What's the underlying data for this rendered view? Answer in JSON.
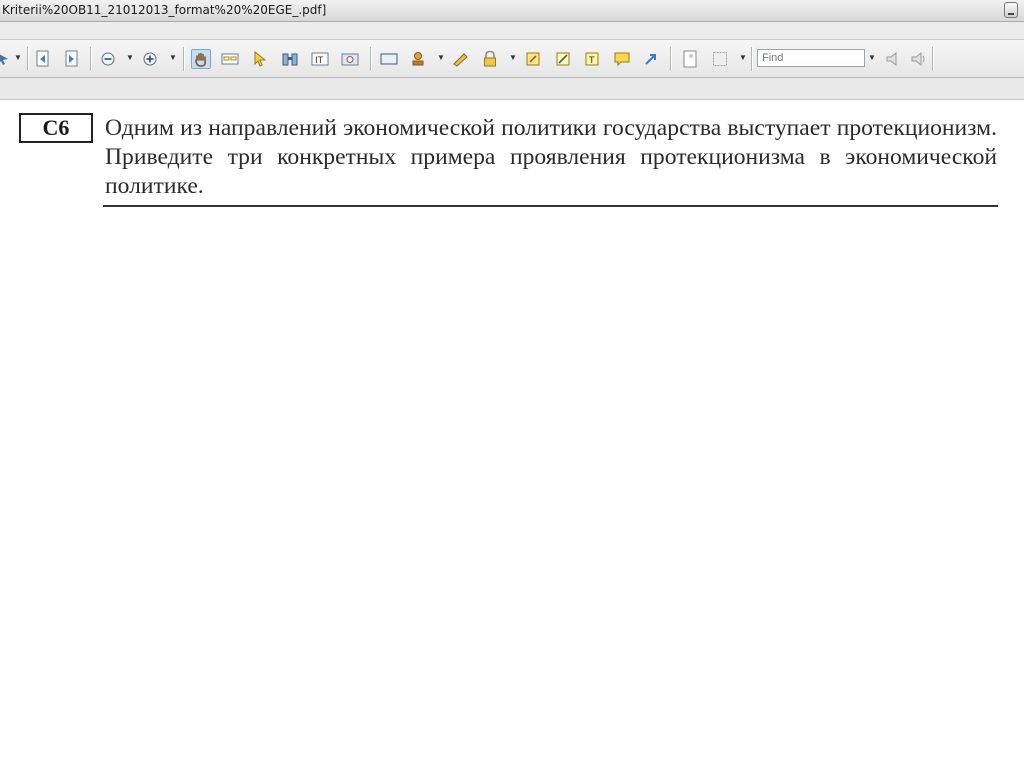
{
  "window": {
    "title": "Kriterii%20OB11_21012013_format%20%20EGE_.pdf]"
  },
  "toolbar": {
    "find_placeholder": "Find",
    "icons": [
      "arrow-icon",
      "page-prev-icon",
      "page-next-icon",
      "zoom-out-icon",
      "zoom-in-icon",
      "hand-icon",
      "glasses-icon",
      "select-arrow-icon",
      "binoculars-icon",
      "text-select-icon",
      "snapshot-icon",
      "form-icon",
      "stamp-icon",
      "sign-icon",
      "lock-icon",
      "note-icon",
      "edit-icon",
      "textbox-icon",
      "comment-icon",
      "arrow-tool-icon",
      "page-icon",
      "grid-icon",
      "audio-prev-icon",
      "audio-next-icon"
    ]
  },
  "document": {
    "question_label": "С6",
    "question_text": "Одним из направлений экономической политики государства выступает протекционизм. Приведите три конкретных примера проявления протекционизма в экономической политике."
  }
}
